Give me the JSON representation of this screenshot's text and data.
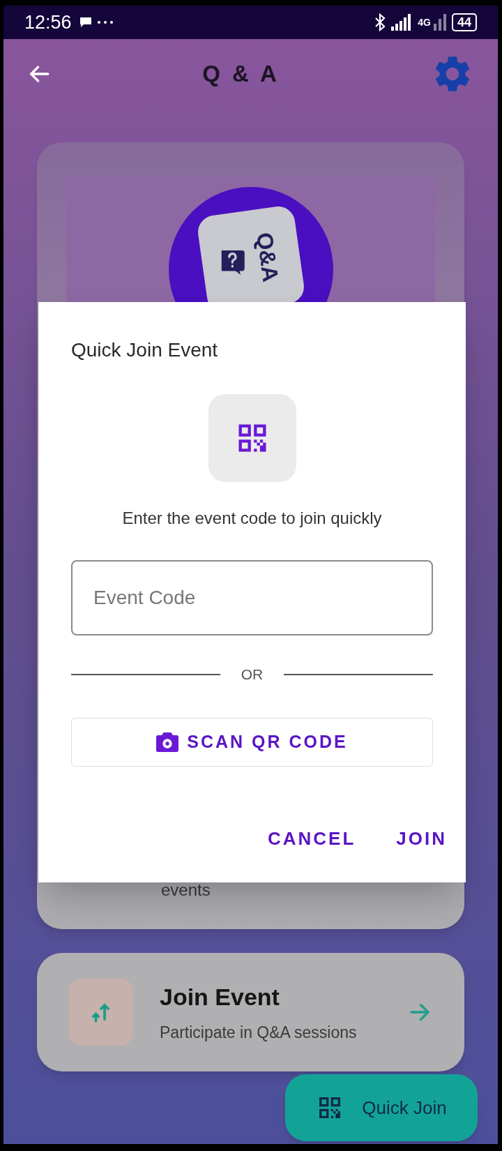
{
  "status_bar": {
    "time": "12:56",
    "network": "4G",
    "battery": "44"
  },
  "app_bar": {
    "title": "Q & A"
  },
  "hero": {
    "logo_text": "Q&A"
  },
  "cards": [
    {
      "kind": "partial",
      "description": "events"
    },
    {
      "kind": "full",
      "title": "Join Event",
      "description": "Participate in Q&A sessions"
    }
  ],
  "fab": {
    "label": "Quick Join"
  },
  "dialog": {
    "title": "Quick Join Event",
    "prompt": "Enter the event code to join quickly",
    "field": {
      "placeholder": "Event Code"
    },
    "divider": "OR",
    "scan_button": "SCAN QR CODE",
    "actions": [
      "CANCEL",
      "JOIN"
    ]
  }
}
